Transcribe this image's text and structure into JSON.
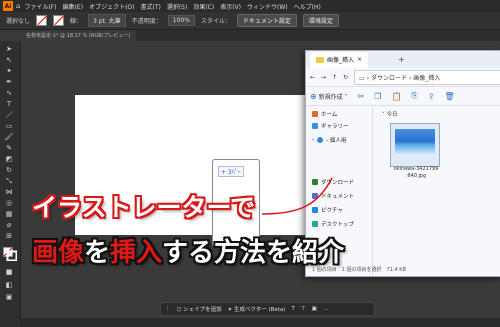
{
  "menubar": {
    "logo": "Ai",
    "items": [
      "ファイル(F)",
      "編集(E)",
      "オブジェクト(O)",
      "書式(T)",
      "選択(S)",
      "効果(C)",
      "表示(V)",
      "ウィンドウ(W)",
      "ヘルプ(H)"
    ]
  },
  "controlbar": {
    "selection_label": "選択なし",
    "stroke_label": "線：",
    "stroke_width": "3 pt. 丸筆",
    "opacity_label": "不透明度：",
    "opacity_value": "100%",
    "style_label": "スタイル：",
    "doc_settings": "ドキュメント設定",
    "env_settings": "環境設定"
  },
  "document_tab": "名称未設定-1* @ 18.17 % (RGB/プレビュー)",
  "placed_chip": "+ 3ﾊﾟｰ",
  "context_bar": {
    "shape_button": "シェイプを追加",
    "vector_button": "生成ベクター (Beta)"
  },
  "dialog": {
    "title": "画像_挿入",
    "path": [
      "ダウンロード",
      "画像_挿入"
    ],
    "new_button": "新規作成",
    "section_label": "今日",
    "sidebar": [
      {
        "label": "ホーム",
        "color": "#e86a2b"
      },
      {
        "label": "ギャラリー",
        "color": "#3a8ee6"
      },
      {
        "label": "- 個人用",
        "color": "#2f8be0"
      },
      {
        "label": "ダウンロード",
        "color": "#2e7d32"
      },
      {
        "label": "ドキュメント",
        "color": "#5c6bc0"
      },
      {
        "label": "ピクチャ",
        "color": "#1e88e5"
      },
      {
        "label": "デスクトップ",
        "color": "#26a69a"
      }
    ],
    "file": {
      "name": "okinawa-3421799 .640.jpg"
    },
    "status": "1 個の項目　1 個の項目を選択　71.4 KB"
  },
  "caption": {
    "line1": "イラストレーターで",
    "line2_parts": [
      {
        "text": "画像",
        "style": "red"
      },
      {
        "text": "を",
        "style": "white"
      },
      {
        "text": "挿入",
        "style": "red"
      },
      {
        "text": "する方法を紹介",
        "style": "white"
      }
    ]
  },
  "colors": {
    "caption_outline_red": "#d81818",
    "caption_red": "#e01818",
    "app_bg": "#3a3a3a"
  }
}
